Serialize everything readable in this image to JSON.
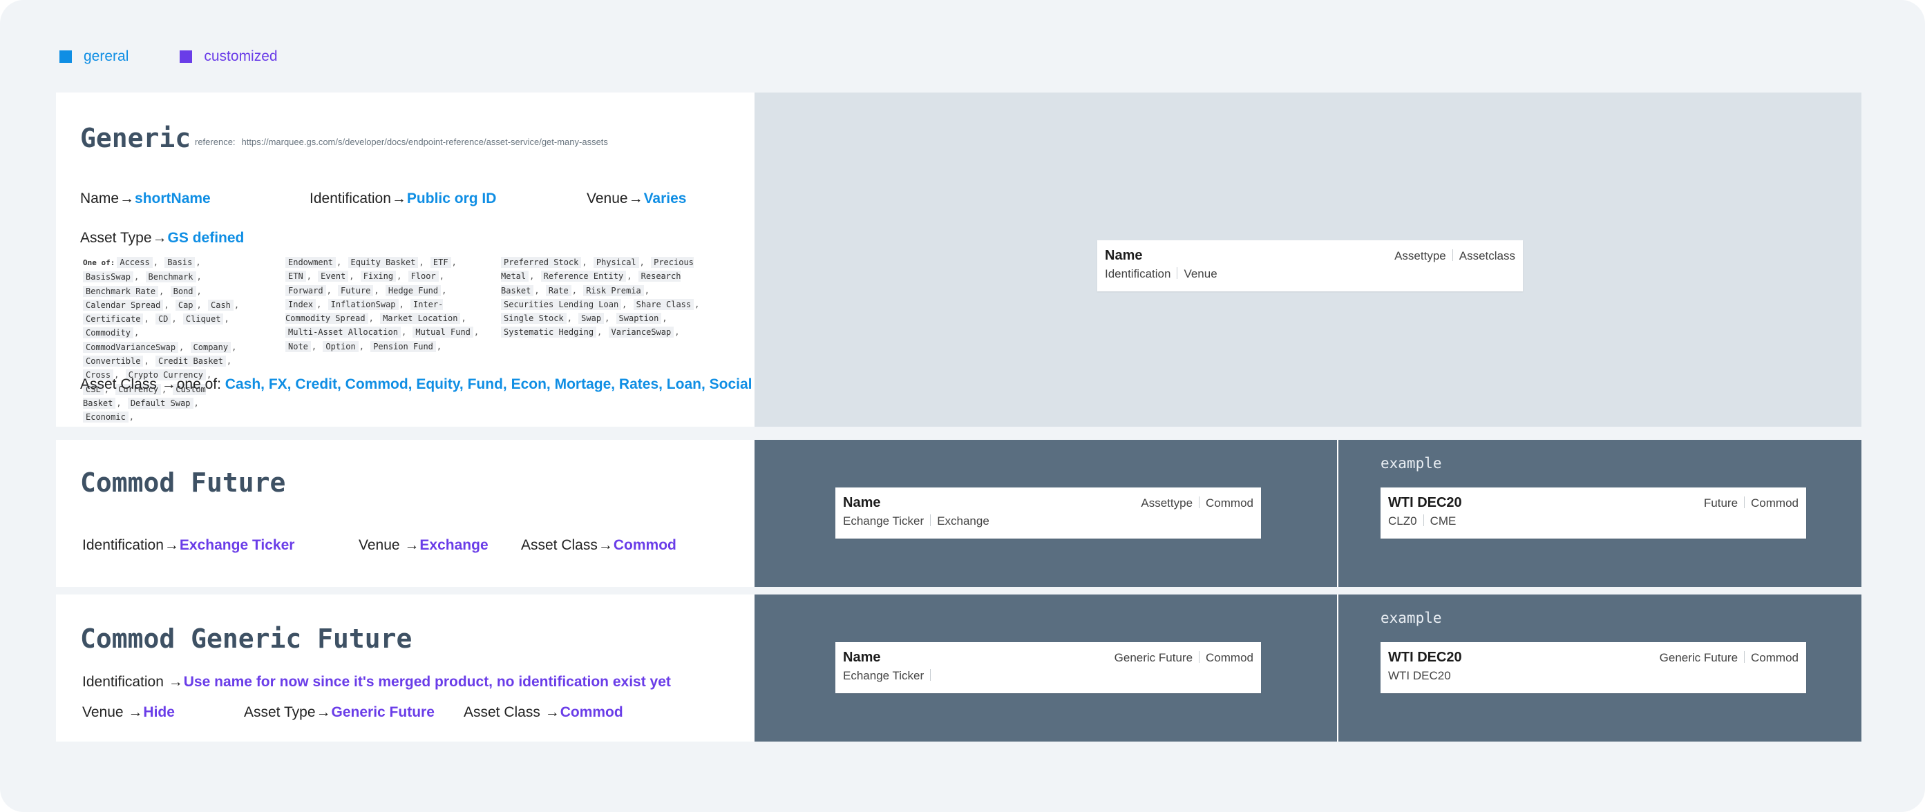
{
  "legend": {
    "general": {
      "label": "gereral",
      "color": "#0f8ee4"
    },
    "customized": {
      "label": "customized",
      "color": "#6a3de8"
    }
  },
  "arrow": "→",
  "sections": {
    "generic": {
      "title": "Generic",
      "reference_label": "reference:",
      "reference_url": "https://marquee.gs.com/s/developer/docs/endpoint-reference/asset-service/get-many-assets",
      "name_label": "Name",
      "name_value": "shortName",
      "identification_label": "Identification",
      "identification_value": "Public org ID",
      "venue_label": "Venue",
      "venue_value": "Varies",
      "asset_type_label": "Asset Type",
      "asset_type_value": "GS defined",
      "one_of_label": "One of:",
      "asset_types": [
        [
          "Access",
          "Basis",
          "BasisSwap",
          "Benchmark",
          "Benchmark Rate",
          "Bond",
          "Calendar Spread",
          "Cap",
          "Cash",
          "Certificate",
          "CD",
          "Cliquet",
          "Commodity",
          "CommodVarianceSwap",
          "Company",
          "Convertible",
          "Credit Basket",
          "Cross",
          "Crypto Currency",
          "CSL",
          "Currency",
          "Custom Basket",
          "Default Swap",
          "Economic"
        ],
        [
          "Endowment",
          "Equity Basket",
          "ETF",
          "ETN",
          "Event",
          "Fixing",
          "Floor",
          "Forward",
          "Future",
          "Hedge Fund",
          "Index",
          "InflationSwap",
          "Inter-Commodity Spread",
          "Market Location",
          "Multi-Asset Allocation",
          "Mutual Fund",
          "Note",
          "Option",
          "Pension Fund"
        ],
        [
          "Preferred Stock",
          "Physical",
          "Precious Metal",
          "Reference Entity",
          "Research Basket",
          "Rate",
          "Risk Premia",
          "Securities Lending Loan",
          "Share Class",
          "Single Stock",
          "Swap",
          "Swaption",
          "Systematic Hedging",
          "VarianceSwap"
        ]
      ],
      "asset_class_label": "Asset Class",
      "asset_class_prefix": "one of:",
      "asset_class_value": "Cash, FX, Credit, Commod, Equity, Fund, Econ, Mortage, Rates, Loan, Social",
      "card": {
        "name": "Name",
        "tag1": "Assettype",
        "tag2": "Assetclass",
        "sub1": "Identification",
        "sub2": "Venue"
      }
    },
    "commod_future": {
      "title": "Commod Future",
      "identification_label": "Identification",
      "identification_value": "Exchange Ticker",
      "venue_label": "Venue",
      "venue_value": "Exchange",
      "asset_class_label": "Asset Class",
      "asset_class_value": "Commod",
      "card": {
        "name": "Name",
        "tag1": "Assettype",
        "tag2": "Commod",
        "sub1": "Echange Ticker",
        "sub2": "Exchange"
      },
      "example_label": "example",
      "example_card": {
        "name": "WTI DEC20",
        "tag1": "Future",
        "tag2": "Commod",
        "sub1": "CLZ0",
        "sub2": "CME"
      }
    },
    "commod_generic_future": {
      "title": "Commod Generic Future",
      "identification_label": "Identification",
      "identification_value": "Use name for now since it's merged product, no identification exist yet",
      "venue_label": "Venue",
      "venue_value": "Hide",
      "asset_type_label": "Asset Type",
      "asset_type_value": "Generic Future",
      "asset_class_label": "Asset Class",
      "asset_class_value": "Commod",
      "card": {
        "name": "Name",
        "tag1": "Generic Future",
        "tag2": "Commod",
        "sub1": "Echange Ticker"
      },
      "example_label": "example",
      "example_card": {
        "name": "WTI DEC20",
        "tag1": "Generic Future",
        "tag2": "Commod",
        "sub1": "WTI DEC20"
      }
    }
  },
  "colors": {
    "panel_grey": "#dbe2e8",
    "panel_dark": "#5a6e80",
    "title": "#3e5164"
  }
}
